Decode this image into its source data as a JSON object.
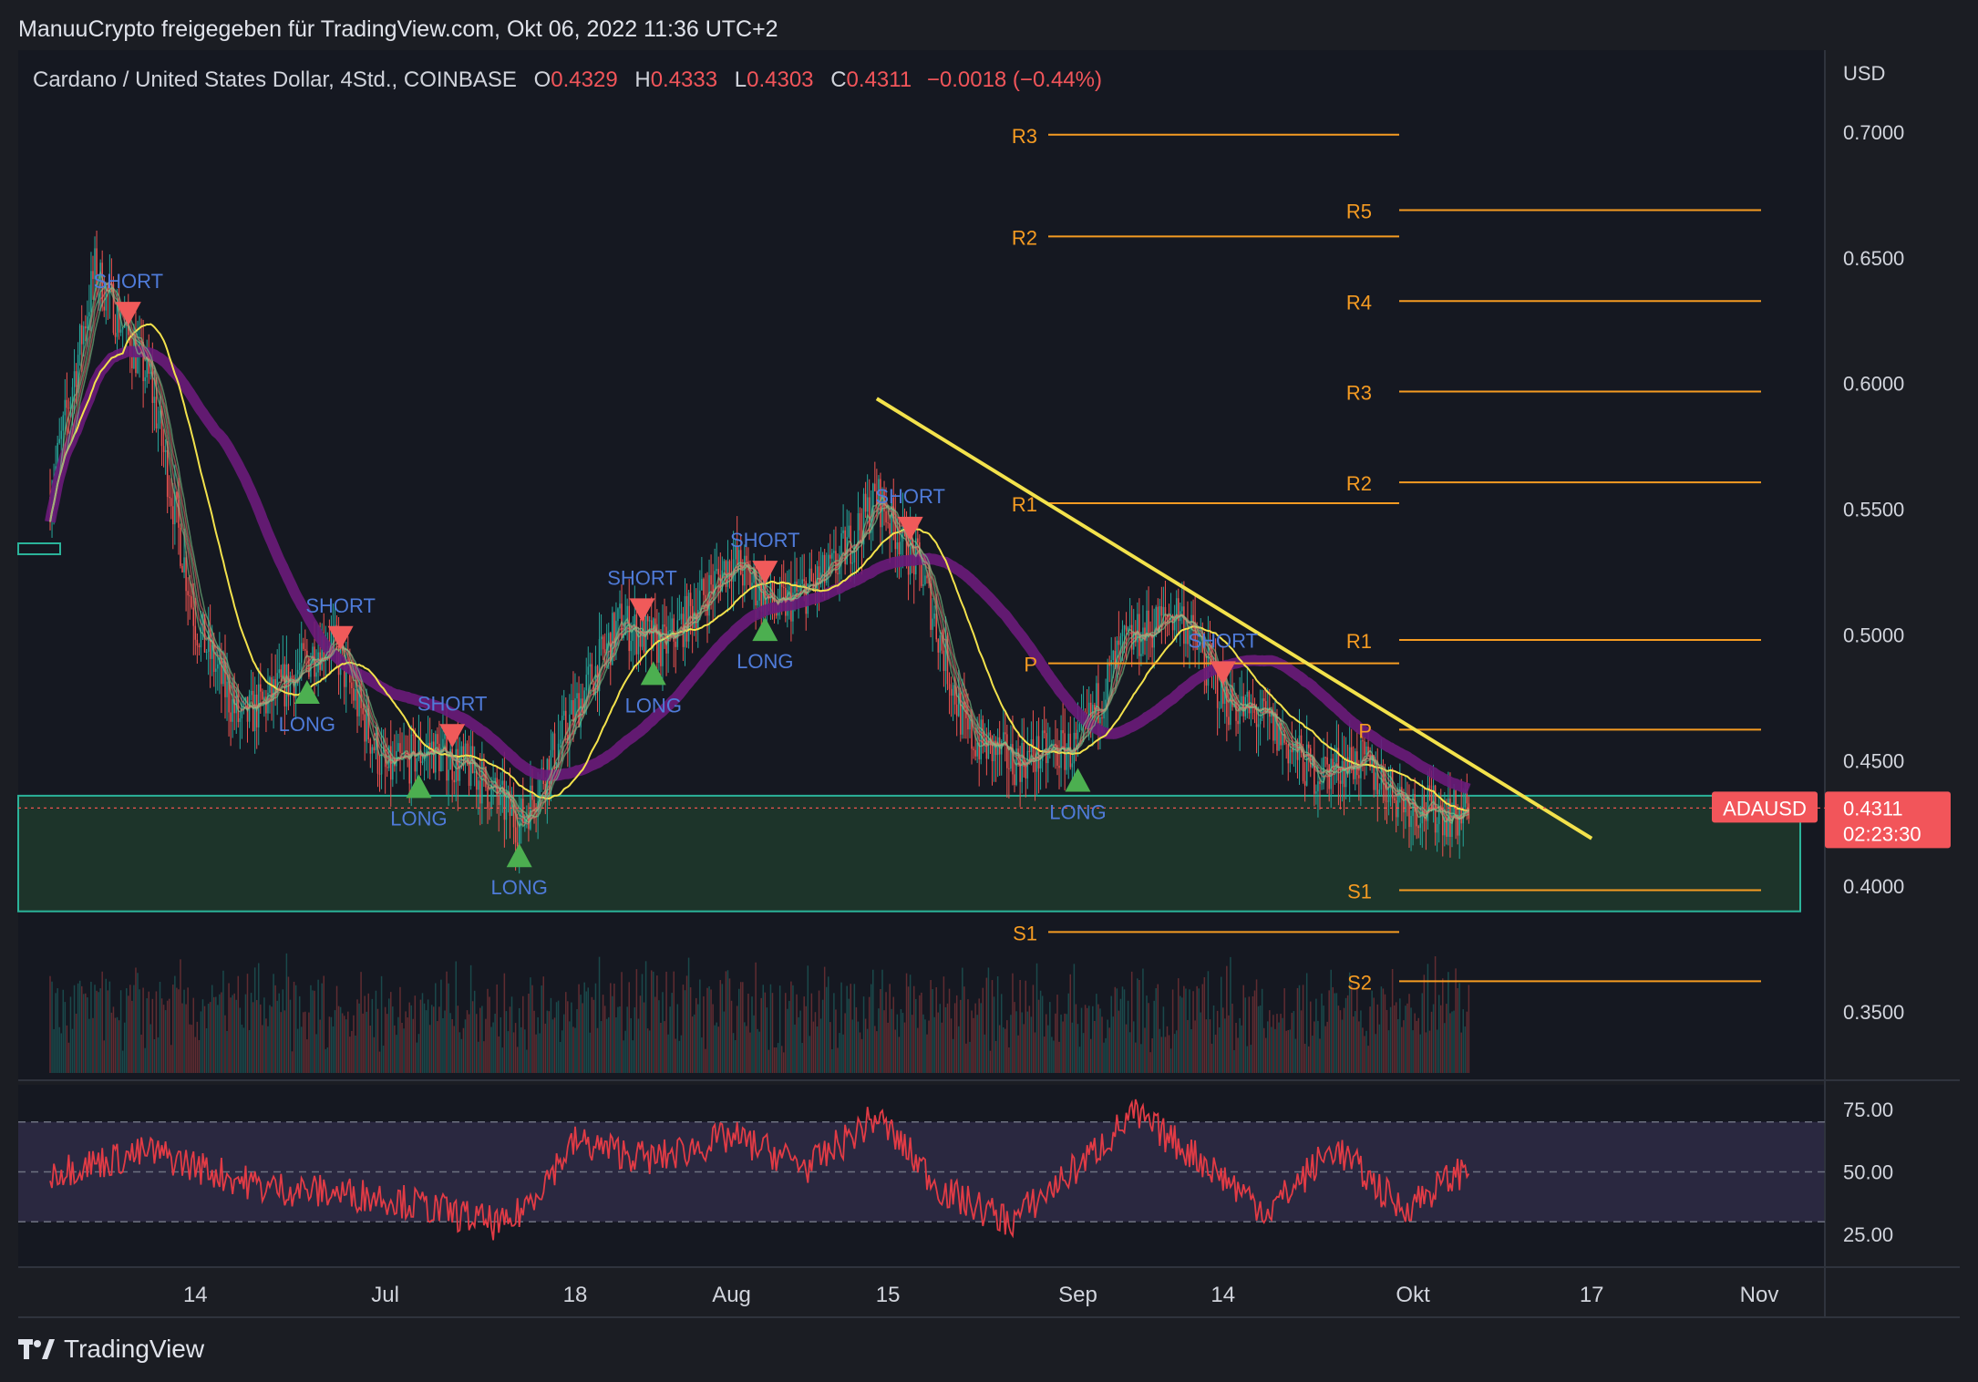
{
  "header": {
    "attribution": "ManuuCrypto freigegeben für TradingView.com, Okt 06, 2022 11:36 UTC+2"
  },
  "legend": {
    "symbol": "Cardano / United States Dollar, 4Std., COINBASE",
    "open_label": "O",
    "open": "0.4329",
    "high_label": "H",
    "high": "0.4333",
    "low_label": "L",
    "low": "0.4303",
    "close_label": "C",
    "close": "0.4311",
    "change": "−0.0018 (−0.44%)"
  },
  "price_axis": {
    "currency": "USD",
    "ticks": [
      "0.7000",
      "0.6500",
      "0.6000",
      "0.5500",
      "0.5000",
      "0.4500",
      "0.4000",
      "0.3500"
    ]
  },
  "price_tag": {
    "symbol": "ADAUSD",
    "price": "0.4311",
    "countdown": "02:23:30"
  },
  "rsi_axis": {
    "ticks": [
      "75.00",
      "50.00",
      "25.00"
    ]
  },
  "time_axis": {
    "ticks": [
      "14",
      "Jul",
      "18",
      "Aug",
      "15",
      "Sep",
      "14",
      "Okt",
      "17",
      "Nov"
    ]
  },
  "brand": {
    "name": "TradingView"
  },
  "colors": {
    "background": "#1b1d23",
    "up_candle": "#26a69a",
    "down_candle": "#ef5350",
    "pivot_line": "#f59b22",
    "trendline": "#f3e24c",
    "long_marker": "#4caf50",
    "short_marker": "#f05a5a",
    "signal_text": "#4f7bd9",
    "slow_ma": "#6a1b7a",
    "fast_ma": "#f3e24c",
    "support_zone": "#1f3a2c",
    "rsi_line": "#e23b45",
    "price_tag": "#f2555a"
  },
  "chart_data": [
    {
      "type": "line",
      "title": "Cardano / United States Dollar, 4Std., COINBASE",
      "x": [
        "2022-06-01",
        "2022-06-05",
        "2022-06-10",
        "2022-06-14",
        "2022-06-18",
        "2022-06-22",
        "2022-06-26",
        "2022-07-01",
        "2022-07-05",
        "2022-07-09",
        "2022-07-13",
        "2022-07-18",
        "2022-07-22",
        "2022-07-26",
        "2022-08-01",
        "2022-08-05",
        "2022-08-10",
        "2022-08-14",
        "2022-08-18",
        "2022-08-22",
        "2022-08-26",
        "2022-09-01",
        "2022-09-05",
        "2022-09-10",
        "2022-09-14",
        "2022-09-18",
        "2022-09-22",
        "2022-09-26",
        "2022-10-01",
        "2022-10-05",
        "2022-10-06"
      ],
      "series": [
        {
          "name": "ADAUSD",
          "values": [
            0.555,
            0.645,
            0.6,
            0.505,
            0.465,
            0.48,
            0.5,
            0.445,
            0.455,
            0.445,
            0.425,
            0.47,
            0.505,
            0.495,
            0.53,
            0.51,
            0.525,
            0.555,
            0.525,
            0.46,
            0.45,
            0.455,
            0.495,
            0.51,
            0.475,
            0.465,
            0.445,
            0.45,
            0.432,
            0.428,
            0.4311
          ]
        }
      ],
      "price_range": [
        0.3225,
        0.725
      ],
      "price_scale": "linear",
      "y_ticks": [
        0.7,
        0.65,
        0.6,
        0.55,
        0.5,
        0.45,
        0.4,
        0.35
      ],
      "trendline": {
        "start": [
          "2022-08-14",
          0.594
        ],
        "end": [
          "2022-10-17",
          0.419
        ]
      },
      "support_zone": [
        0.39,
        0.436
      ],
      "pivot_levels_monthly": [
        {
          "label": "R3",
          "value": 0.699
        },
        {
          "label": "R2",
          "value": 0.6585
        },
        {
          "label": "R1",
          "value": 0.5524
        },
        {
          "label": "P",
          "value": 0.4887
        },
        {
          "label": "S1",
          "value": 0.3818
        }
      ],
      "pivot_levels_current": [
        {
          "label": "R5",
          "value": 0.669
        },
        {
          "label": "R4",
          "value": 0.6328
        },
        {
          "label": "R3",
          "value": 0.5968
        },
        {
          "label": "R2",
          "value": 0.5607
        },
        {
          "label": "R1",
          "value": 0.498
        },
        {
          "label": "P",
          "value": 0.4623
        },
        {
          "label": "S1",
          "value": 0.3984
        },
        {
          "label": "S2",
          "value": 0.3622
        }
      ],
      "signals": [
        {
          "type": "SHORT",
          "date": "2022-06-08"
        },
        {
          "type": "SHORT",
          "date": "2022-06-27"
        },
        {
          "type": "LONG",
          "date": "2022-06-24"
        },
        {
          "type": "LONG",
          "date": "2022-07-04"
        },
        {
          "type": "SHORT",
          "date": "2022-07-07"
        },
        {
          "type": "LONG",
          "date": "2022-07-13"
        },
        {
          "type": "SHORT",
          "date": "2022-07-24"
        },
        {
          "type": "LONG",
          "date": "2022-07-25"
        },
        {
          "type": "SHORT",
          "date": "2022-08-04"
        },
        {
          "type": "LONG",
          "date": "2022-08-04"
        },
        {
          "type": "SHORT",
          "date": "2022-08-17"
        },
        {
          "type": "LONG",
          "date": "2022-09-01"
        },
        {
          "type": "SHORT",
          "date": "2022-09-14"
        }
      ],
      "legend_position": "top-left"
    },
    {
      "type": "line",
      "title": "",
      "x": [
        "2022-06-01",
        "2022-06-10",
        "2022-06-20",
        "2022-07-01",
        "2022-07-12",
        "2022-07-18",
        "2022-07-25",
        "2022-08-01",
        "2022-08-08",
        "2022-08-14",
        "2022-08-20",
        "2022-08-26",
        "2022-09-01",
        "2022-09-06",
        "2022-09-12",
        "2022-09-18",
        "2022-09-24",
        "2022-09-30",
        "2022-10-06"
      ],
      "series": [
        {
          "name": "RSI",
          "values": [
            50,
            58,
            44,
            40,
            28,
            62,
            55,
            64,
            52,
            72,
            42,
            30,
            52,
            73,
            55,
            34,
            60,
            35,
            52
          ]
        }
      ],
      "ylim": [
        10,
        85
      ],
      "bands": [
        30,
        50,
        70
      ],
      "y_ticks": [
        75,
        50,
        25
      ]
    }
  ]
}
